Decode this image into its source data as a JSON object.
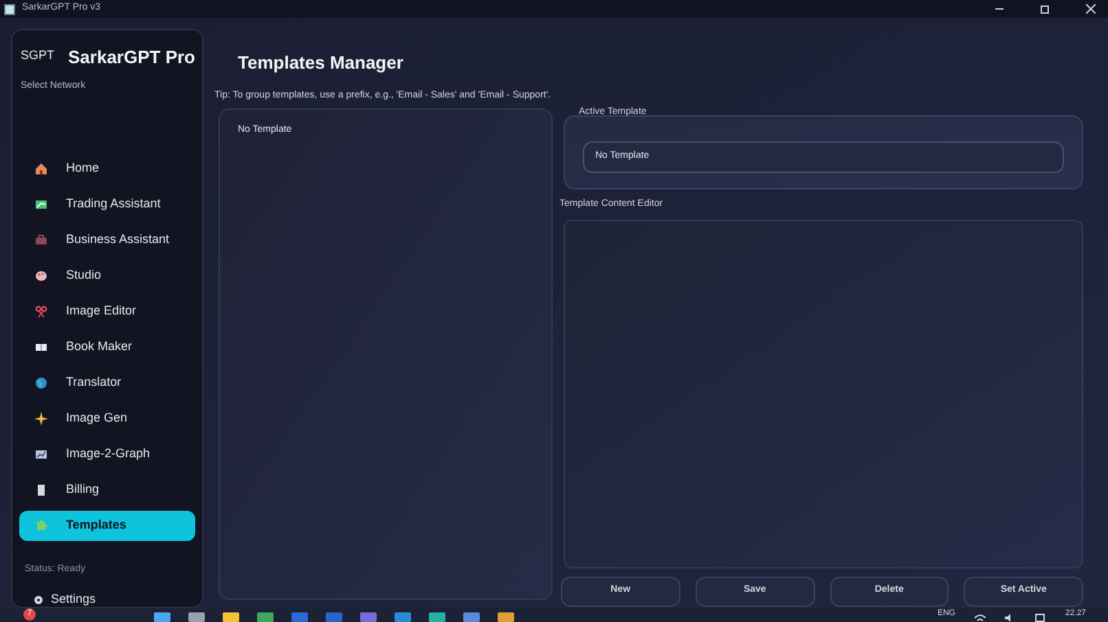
{
  "window": {
    "title": "SarkarGPT Pro v3"
  },
  "sidebar": {
    "logo": "SGPT",
    "app_name": "SarkarGPT Pro",
    "network_label": "Select Network",
    "items": [
      {
        "label": "Home",
        "selected": false
      },
      {
        "label": "Trading Assistant",
        "selected": false
      },
      {
        "label": "Business Assistant",
        "selected": false
      },
      {
        "label": "Studio",
        "selected": false
      },
      {
        "label": "Image Editor",
        "selected": false
      },
      {
        "label": "Book Maker",
        "selected": false
      },
      {
        "label": "Translator",
        "selected": false
      },
      {
        "label": "Image Gen",
        "selected": false
      },
      {
        "label": "Image-2-Graph",
        "selected": false
      },
      {
        "label": "Billing",
        "selected": false
      },
      {
        "label": "Templates",
        "selected": true
      }
    ],
    "status": "Status: Ready",
    "settings": "Settings"
  },
  "main": {
    "title": "Templates Manager",
    "tip": "Tip: To group templates, use a prefix, e.g., 'Email - Sales' and 'Email - Support'.",
    "template_list": [
      "No Template"
    ],
    "active_template": {
      "label": "Active Template",
      "value": "No Template"
    },
    "editor_label": "Template Content Editor",
    "buttons": [
      "New",
      "Save",
      "Delete",
      "Set Active"
    ]
  },
  "taskbar": {
    "badge": "7",
    "language": "ENG",
    "time": "22.27"
  }
}
